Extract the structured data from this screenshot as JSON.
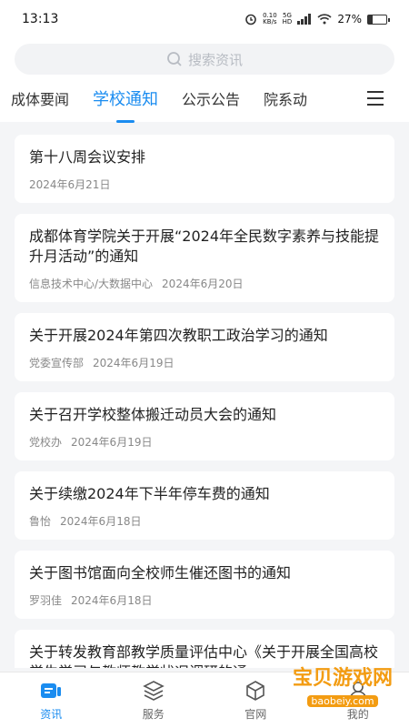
{
  "status_bar": {
    "time": "13:13",
    "speed_value": "0.10",
    "speed_unit": "KB/s",
    "net1": "5G",
    "net2": "HD",
    "battery": "27%",
    "battery_level": 0.27
  },
  "search": {
    "placeholder": "搜索资讯"
  },
  "tabs": [
    {
      "label": "成体要闻",
      "active": false
    },
    {
      "label": "学校通知",
      "active": true
    },
    {
      "label": "公示公告",
      "active": false
    },
    {
      "label": "院系动",
      "active": false
    }
  ],
  "news": [
    {
      "title": "第十八周会议安排",
      "source": "",
      "date": "2024年6月21日"
    },
    {
      "title": "成都体育学院关于开展“2024年全民数字素养与技能提升月活动”的通知",
      "source": "信息技术中心/大数据中心",
      "date": "2024年6月20日"
    },
    {
      "title": "关于开展2024年第四次教职工政治学习的通知",
      "source": "党委宣传部",
      "date": "2024年6月19日"
    },
    {
      "title": "关于召开学校整体搬迁动员大会的通知",
      "source": "党校办",
      "date": "2024年6月19日"
    },
    {
      "title": "关于续缴2024年下半年停车费的通知",
      "source": "鲁怡",
      "date": "2024年6月18日"
    },
    {
      "title": "关于图书馆面向全校师生催还图书的通知",
      "source": "罗羽佳",
      "date": "2024年6月18日"
    },
    {
      "title": "关于转发教育部教学质量评估中心《关于开展全国高校学生学习与教师教学状况调研的通···",
      "source": "",
      "date": ""
    }
  ],
  "tabbar": [
    {
      "label": "资讯",
      "icon": "news-icon",
      "active": true
    },
    {
      "label": "服务",
      "icon": "layers-icon",
      "active": false
    },
    {
      "label": "官网",
      "icon": "cube-icon",
      "active": false
    },
    {
      "label": "我的",
      "icon": "user-icon",
      "active": false
    }
  ],
  "watermark": {
    "title": "宝贝游戏网",
    "url": "baobeiy.com"
  },
  "colors": {
    "accent": "#1a8cf0",
    "watermark": "#f39c12"
  }
}
